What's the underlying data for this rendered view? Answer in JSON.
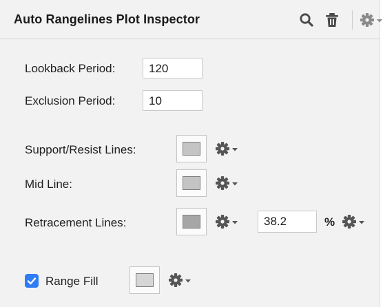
{
  "header": {
    "title": "Auto Rangelines Plot Inspector",
    "icons": [
      "search-icon",
      "trash-icon",
      "gear-menu-icon"
    ]
  },
  "fields": {
    "lookback": {
      "label": "Lookback Period:",
      "value": "120"
    },
    "exclusion": {
      "label": "Exclusion Period:",
      "value": "10"
    }
  },
  "lines": {
    "support_resist": {
      "label": "Support/Resist Lines:",
      "color": "#c4c4c4"
    },
    "mid": {
      "label": "Mid Line:",
      "color": "#c4c4c4"
    },
    "retracement": {
      "label": "Retracement Lines:",
      "color": "#a6a6a6",
      "percent_value": "38.2",
      "percent_symbol": "%"
    }
  },
  "range_fill": {
    "label": "Range Fill",
    "checked": true,
    "color": "#d6d6d6"
  },
  "colors": {
    "panel_bg": "#f2f2f2",
    "checkbox_blue": "#2f7cf6",
    "icon_gray": "#5a5a5a"
  }
}
